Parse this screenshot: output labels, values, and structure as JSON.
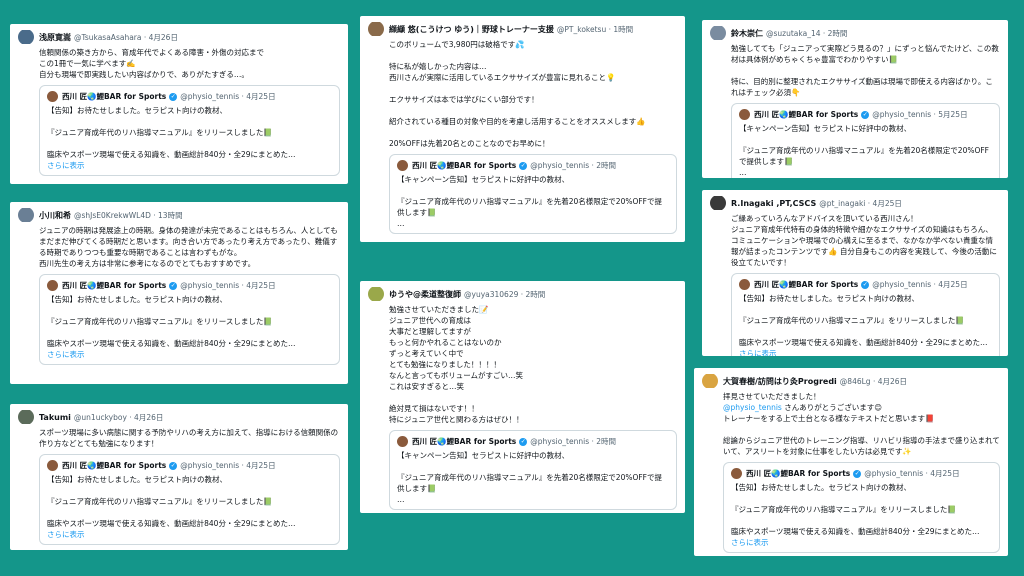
{
  "tweets": [
    {
      "name": "浅原寛嵩",
      "handle": "@TsukasaAsahara",
      "time": "4月26日",
      "avatar_color": "#4a6b8a",
      "text": "信頼関係の築き方から、育成年代でよくある障害・外傷の対応まで\nこの1冊で一気に学べます✍️\n自分も現場で即実践したい内容ばかりで、ありがたすぎる…。",
      "quote": {
        "name": "西川 匠🌏鯉BAR for Sports",
        "handle": "@physio_tennis",
        "time": "4月25日",
        "text": "【告知】お待たせしました。セラピスト向けの教材、\n\n『ジュニア育成年代のリハ指導マニュアル』をリリースしました📗\n\n臨床やスポーツ現場で使える知識を、動画総計840分・全29にまとめた…",
        "more": "さらに表示"
      }
    },
    {
      "name": "小川和希",
      "handle": "@shJsE0KrekwWL4D",
      "time": "13時間",
      "avatar_color": "#6a7f95",
      "text": "ジュニアの時期は発展途上の時期。身体の発達が未完であることはもちろん、人としてもまだまだ伸びてくる時期だと思います。向き合い方であったり考え方であったり、難儀する時期でありつつも重要な時期であることは言わずもがな。\n西川先生の考え方は非常に参考になるのでとてもおすすめです。",
      "quote": {
        "name": "西川 匠🌏鯉BAR for Sports",
        "handle": "@physio_tennis",
        "time": "4月25日",
        "text": "【告知】お待たせしました。セラピスト向けの教材、\n\n『ジュニア育成年代のリハ指導マニュアル』をリリースしました📗\n\n臨床やスポーツ現場で使える知識を、動画総計840分・全29にまとめた…",
        "more": "さらに表示"
      }
    },
    {
      "name": "Takumi",
      "handle": "@un1uckyboy",
      "time": "4月26日",
      "avatar_color": "#5b6b5a",
      "text": "スポーツ現場に多い病態に関する予防やリハの考え方に加えて、指導における信頼関係の作り方などとても勉強になります！",
      "quote": {
        "name": "西川 匠🌏鯉BAR for Sports",
        "handle": "@physio_tennis",
        "time": "4月25日",
        "text": "【告知】お待たせしました。セラピスト向けの教材、\n\n『ジュニア育成年代のリハ指導マニュアル』をリリースしました📗\n\n臨床やスポーツ現場で使える知識を、動画総計840分・全29にまとめた…",
        "more": "さらに表示"
      }
    },
    {
      "name": "纐纈 悠(こうけつ ゆう)｜野球トレーナー支援",
      "handle": "@PT_koketsu",
      "time": "1時間",
      "avatar_color": "#8a6a4a",
      "text": "このボリュームで3,980円は破格です💦\n\n特に私が嬉しかった内容は…\n西川さんが実際に活用しているエクササイズが豊富に見れること💡\n\nエクササイズは本では学びにくい部分です！\n\n紹介されている種目の対象や目的を考慮し活用することをオススメします👍\n\n20%OFFは先着20名とのことなのでお早めに！",
      "quote": {
        "name": "西川 匠🌏鯉BAR for Sports",
        "handle": "@physio_tennis",
        "time": "2時間",
        "text": "【キャンペーン告知】セラピストに好評中の教材、\n\n『ジュニア育成年代のリハ指導マニュアル』を先着20名様限定で20%OFFで提供します📗\n…",
        "more": ""
      }
    },
    {
      "name": "ゆうや@柔道整復師",
      "handle": "@yuya310629",
      "time": "2時間",
      "avatar_color": "#9aa84a",
      "text": "勉強させていただきました📝\nジュニア世代への育成は\n大事だと理解してますが\nもっと何かやれることはないのか\nずっと考えていく中で\nとても勉強になりました！！！！\nなんと言ってもボリュームがすごい…笑\nこれは安すぎると…笑\n\n絶対見て損はないです！！\n特にジュニア世代と関わる方はぜひ！！",
      "quote": {
        "name": "西川 匠🌏鯉BAR for Sports",
        "handle": "@physio_tennis",
        "time": "2時間",
        "text": "【キャンペーン告知】セラピストに好評中の教材、\n\n『ジュニア育成年代のリハ指導マニュアル』を先着20名様限定で20%OFFで提供します📗\n…",
        "more": ""
      }
    },
    {
      "name": "鈴木崇仁",
      "handle": "@suzutaka_14",
      "time": "2時間",
      "avatar_color": "#7a8ca0",
      "text": "勉強してても「ジュニアって実際どう見るの？」にずっと悩んでたけど、この教材は具体例がめちゃくちゃ豊富でわかりやすい📗\n\n特に、目的別に整理されたエクササイズ動画は現場で即使える内容ばかり。これはチェック必須👇",
      "quote": {
        "name": "西川 匠🌏鯉BAR for Sports",
        "handle": "@physio_tennis",
        "time": "5月25日",
        "text": "【キャンペーン告知】セラピストに好評中の教材、\n\n『ジュニア育成年代のリハ指導マニュアル』を先着20名様限定で20%OFFで提供します📗\n…",
        "more": ""
      }
    },
    {
      "name": "R.Inagaki ,PT,CSCS",
      "handle": "@pt_inagaki",
      "time": "4月25日",
      "avatar_color": "#3a3a3a",
      "text": "ご縁あっていろんなアドバイスを頂いている西川さん！\nジュニア育成年代特有の身体的特徴や細かなエクササイズの知識はもちろん、コミュニケーションや現場での心構えに至るまで、なかなか学べない貴重な情報が詰まったコンテンツです👍 自分自身もこの内容を実践して、今後の活動に役立てたいです！",
      "quote": {
        "name": "西川 匠🌏鯉BAR for Sports",
        "handle": "@physio_tennis",
        "time": "4月25日",
        "text": "【告知】お待たせしました。セラピスト向けの教材、\n\n『ジュニア育成年代のリハ指導マニュアル』をリリースしました📗\n\n臨床やスポーツ現場で使える知識を、動画総計840分・全29にまとめた…",
        "more": "さらに表示"
      }
    },
    {
      "name": "大賀春樹/訪問はり灸Progredi",
      "handle": "@846Lg",
      "time": "4月26日",
      "avatar_color": "#d9a441",
      "mention": "@physio_tennis",
      "text_after_mention": " さんありがとうございます😊\nトレーナーをする上で土台となる様なテキストだと思います📕\n\n総論からジュニア世代のトレーニング指導、リハビリ指導の手法まで盛り込まれていて、アスリートを対象に仕事をしたい方は必見です✨",
      "text": "拝見させていただきました！",
      "quote": {
        "name": "西川 匠🌏鯉BAR for Sports",
        "handle": "@physio_tennis",
        "time": "4月25日",
        "text": "【告知】お待たせしました。セラピスト向けの教材、\n\n『ジュニア育成年代のリハ指導マニュアル』をリリースしました📗\n\n臨床やスポーツ現場で使える知識を、動画総計840分・全29にまとめた…",
        "more": "さらに表示"
      }
    }
  ]
}
